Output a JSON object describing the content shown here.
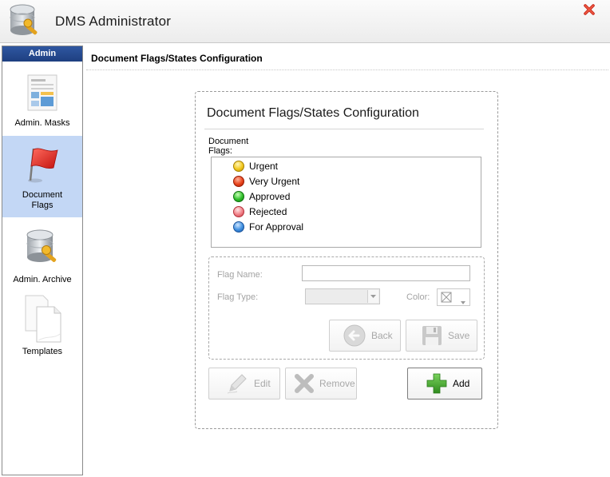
{
  "window": {
    "title": "DMS Administrator",
    "app_icon": "database-key-icon",
    "close_icon": "close-icon"
  },
  "sidebar": {
    "header": "Admin",
    "items": [
      {
        "label": "Admin. Masks",
        "icon": "masks-document-icon",
        "active": false
      },
      {
        "label": "Document\nFlags",
        "icon": "red-flag-icon",
        "active": true
      },
      {
        "label": "Admin. Archive",
        "icon": "archive-database-icon",
        "active": false
      },
      {
        "label": "Templates",
        "icon": "templates-pages-icon",
        "active": false
      }
    ]
  },
  "main": {
    "page_title": "Document Flags/States Configuration",
    "panel": {
      "title": "Document Flags/States Configuration",
      "flags_label": "Document Flags:",
      "flags": [
        {
          "name": "Urgent",
          "color": "#f2c81d"
        },
        {
          "name": "Very Urgent",
          "color": "#e8431b"
        },
        {
          "name": "Approved",
          "color": "#2fbf2a"
        },
        {
          "name": "Rejected",
          "color": "#f07f86"
        },
        {
          "name": "For Approval",
          "color": "#3f8fe0"
        }
      ],
      "form": {
        "flag_name_label": "Flag Name:",
        "flag_name_value": "",
        "flag_type_label": "Flag Type:",
        "flag_type_value": "",
        "color_label": "Color:",
        "back_label": "Back",
        "save_label": "Save"
      },
      "actions": {
        "edit_label": "Edit",
        "remove_label": "Remove",
        "add_label": "Add"
      }
    }
  },
  "colors": {
    "sidebar_header_bg": "#2b529b",
    "sidebar_active_bg": "#c3d7f5",
    "add_icon_green": "#3d9e2c"
  }
}
